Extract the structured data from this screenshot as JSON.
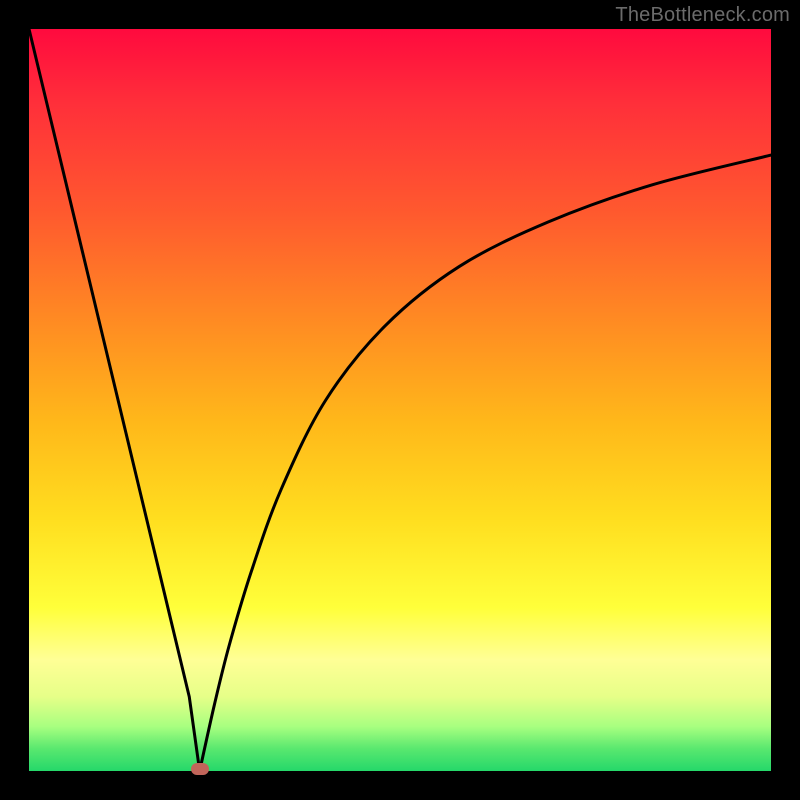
{
  "watermark": "TheBottleneck.com",
  "chart_data": {
    "type": "line",
    "title": "",
    "xlabel": "",
    "ylabel": "",
    "xlim": [
      0,
      100
    ],
    "ylim": [
      0,
      100
    ],
    "background_gradient": {
      "direction": "vertical",
      "stops": [
        {
          "pos": 0,
          "color": "#ff0a3e"
        },
        {
          "pos": 25,
          "color": "#ff5a2e"
        },
        {
          "pos": 53,
          "color": "#ffb81a"
        },
        {
          "pos": 78,
          "color": "#ffff3a"
        },
        {
          "pos": 100,
          "color": "#25d86a"
        }
      ],
      "meaning": "red=high bottleneck, green=low bottleneck"
    },
    "series": [
      {
        "name": "left-branch",
        "x": [
          0,
          2.4,
          4.8,
          7.2,
          9.6,
          12.0,
          14.4,
          16.8,
          19.2,
          21.6,
          23.0
        ],
        "y": [
          100,
          90,
          80,
          70,
          60,
          50,
          40,
          30,
          20,
          10,
          0
        ]
      },
      {
        "name": "right-branch",
        "x": [
          23.0,
          25,
          27,
          30,
          34,
          40,
          48,
          58,
          70,
          84,
          100
        ],
        "y": [
          0,
          9,
          17,
          27,
          38,
          50,
          60,
          68,
          74,
          79,
          83
        ]
      }
    ],
    "marker": {
      "x": 23.0,
      "y": 0,
      "color": "#c1655a"
    }
  },
  "colors": {
    "curve": "#000000",
    "frame": "#000000",
    "marker": "#c1655a",
    "watermark": "#6b6b6b"
  }
}
